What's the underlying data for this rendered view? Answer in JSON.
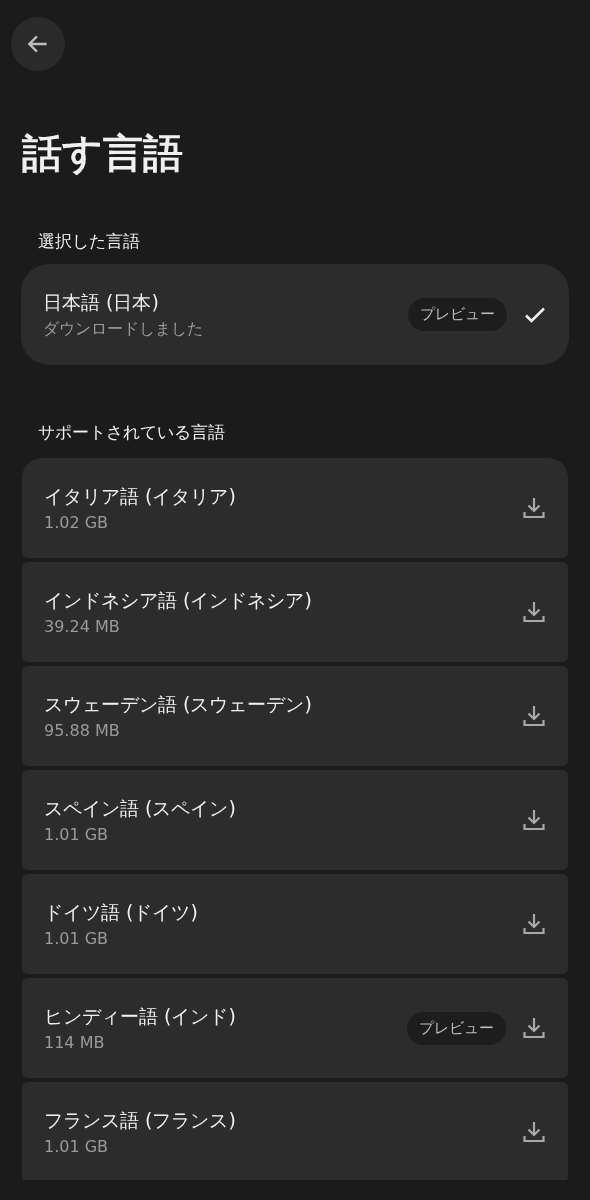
{
  "title": "話す言語",
  "selected_section": {
    "label": "選択した言語",
    "items": [
      {
        "name": "日本語 (日本)",
        "detail": "ダウンロードしました",
        "badge": "プレビュー",
        "kind": "installed"
      }
    ]
  },
  "supported_section": {
    "label": "サポートされている言語",
    "items": [
      {
        "name": "イタリア語 (イタリア)",
        "detail": "1.02 GB",
        "kind": "download"
      },
      {
        "name": "インドネシア語 (インドネシア)",
        "detail": "39.24 MB",
        "kind": "download"
      },
      {
        "name": "スウェーデン語 (スウェーデン)",
        "detail": "95.88 MB",
        "kind": "download"
      },
      {
        "name": "スペイン語 (スペイン)",
        "detail": "1.01 GB",
        "kind": "download"
      },
      {
        "name": "ドイツ語 (ドイツ)",
        "detail": "1.01 GB",
        "kind": "download"
      },
      {
        "name": "ヒンディー語 (インド)",
        "detail": "114 MB",
        "badge": "プレビュー",
        "kind": "download"
      },
      {
        "name": "フランス語 (フランス)",
        "detail": "1.01 GB",
        "kind": "download"
      }
    ]
  }
}
